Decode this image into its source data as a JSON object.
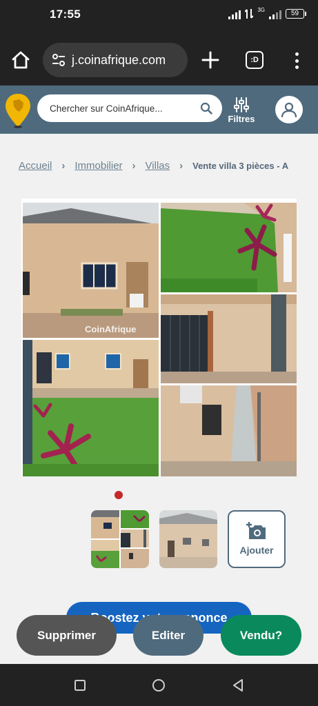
{
  "status_bar": {
    "time": "17:55",
    "network": "3G",
    "battery": "59"
  },
  "browser": {
    "url": "j.coinafrique.com",
    "tabs_label": ":D"
  },
  "site_header": {
    "search_placeholder": "Chercher sur CoinAfrique...",
    "filters_label": "Filtres"
  },
  "breadcrumb": {
    "items": [
      "Accueil",
      "Immobilier",
      "Villas"
    ],
    "current": "Vente villa 3 pièces - A"
  },
  "gallery": {
    "watermark": "CoinAfrique",
    "photo_count": 5
  },
  "thumbnails": {
    "add_label": "Ajouter"
  },
  "actions": {
    "boost": "Boostez votre annonce",
    "delete": "Supprimer",
    "edit": "Editer",
    "sold": "Vendu?"
  },
  "colors": {
    "brand": "#4f6a7d",
    "boost": "#1565c0",
    "sold": "#0a8a5c",
    "delete": "#555555",
    "active_dot": "#c62828"
  },
  "icons": [
    "home-icon",
    "tune-icon",
    "plus-icon",
    "tabs-icon",
    "more-vert-icon",
    "map-pin-logo-icon",
    "search-icon",
    "sliders-icon",
    "user-icon",
    "add-photo-icon",
    "nav-square-icon",
    "nav-circle-icon",
    "nav-back-icon"
  ]
}
